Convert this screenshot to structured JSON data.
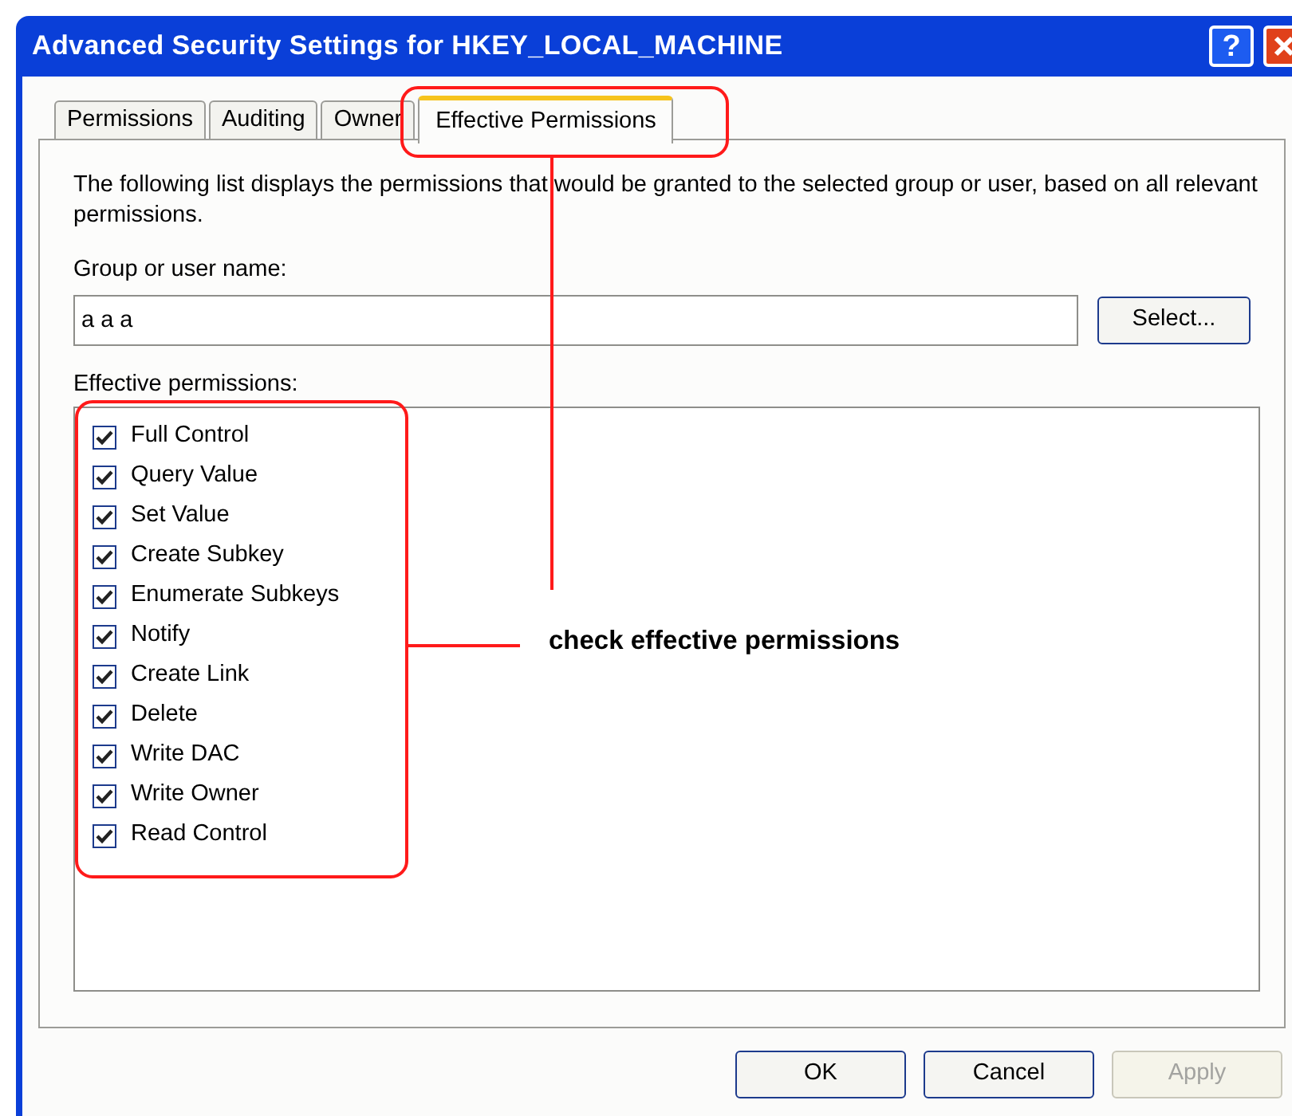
{
  "window": {
    "title": "Advanced Security Settings for HKEY_LOCAL_MACHINE",
    "help": "?"
  },
  "tabs": [
    {
      "label": "Permissions",
      "selected": false
    },
    {
      "label": "Auditing",
      "selected": false
    },
    {
      "label": "Owner",
      "selected": false
    },
    {
      "label": "Effective Permissions",
      "selected": true
    }
  ],
  "description": "The following list displays the permissions that would be granted to the selected group or user, based on all relevant permissions.",
  "group_label": "Group or user name:",
  "group_field": {
    "value": "a a a"
  },
  "select_button": "Select...",
  "permissions_label": "Effective permissions:",
  "permissions": [
    {
      "label": "Full Control",
      "checked": true
    },
    {
      "label": "Query Value",
      "checked": true
    },
    {
      "label": "Set Value",
      "checked": true
    },
    {
      "label": "Create Subkey",
      "checked": true
    },
    {
      "label": "Enumerate Subkeys",
      "checked": true
    },
    {
      "label": "Notify",
      "checked": true
    },
    {
      "label": "Create Link",
      "checked": true
    },
    {
      "label": "Delete",
      "checked": true
    },
    {
      "label": "Write DAC",
      "checked": true
    },
    {
      "label": "Write Owner",
      "checked": true
    },
    {
      "label": "Read Control",
      "checked": true
    }
  ],
  "annotation": "check effective permissions",
  "buttons": [
    {
      "label": "OK",
      "disabled": false
    },
    {
      "label": "Cancel",
      "disabled": false
    },
    {
      "label": "Apply",
      "disabled": true
    }
  ]
}
